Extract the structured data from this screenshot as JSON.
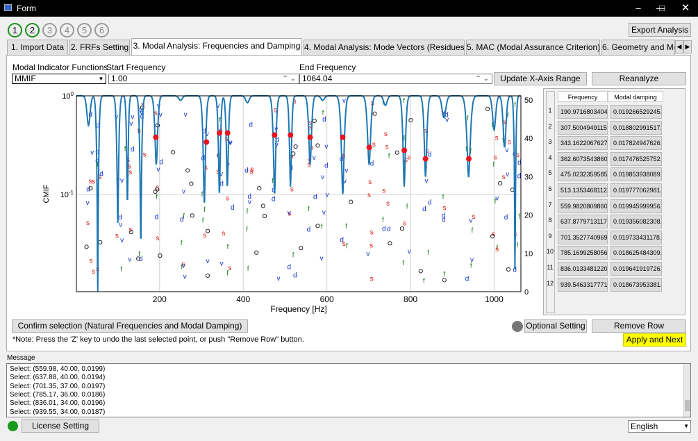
{
  "window": {
    "title": "Form"
  },
  "steps": [
    {
      "n": "1",
      "done": true
    },
    {
      "n": "2",
      "done": true
    },
    {
      "n": "3",
      "done": false
    },
    {
      "n": "4",
      "done": false
    },
    {
      "n": "5",
      "done": false
    },
    {
      "n": "6",
      "done": false
    }
  ],
  "export_label": "Export Analysis",
  "tabs": [
    "1. Import Data",
    "2. FRFs Setting",
    "3. Modal Analysis: Frequencies and Damping",
    "4. Modal Analysis: Mode Vectors (Residues)",
    "5. MAC (Modal Assurance Criterion)",
    "6. Geometry and Mo"
  ],
  "controls": {
    "mif_label": "Modal Indicator Functions",
    "mif_value": "MMIF",
    "start_label": "Start Frequency",
    "start_value": "1.00",
    "end_label": "End Frequency",
    "end_value": "1064.04",
    "update_label": "Update X-Axis Range",
    "reanalyze_label": "Reanalyze"
  },
  "chart_data": {
    "type": "line",
    "xlabel": "Frequency [Hz]",
    "ylabel": "CMIF",
    "x_ticks": [
      "200",
      "400",
      "600",
      "800",
      "1000"
    ],
    "y_ticks_left": [
      "10^0",
      "10^-1"
    ],
    "y_ticks_right": [
      "0",
      "10",
      "20",
      "30",
      "40",
      "50"
    ],
    "xlim": [
      1,
      1064.04
    ],
    "ylog": true,
    "grid": true,
    "selected_points": [
      [
        190.97,
        0.38
      ],
      [
        312,
        0.34
      ],
      [
        343.16,
        0.42
      ],
      [
        362.61,
        0.42
      ],
      [
        475.02,
        0.4
      ],
      [
        513.14,
        0.4
      ],
      [
        559.98,
        0.38
      ],
      [
        637.88,
        0.38
      ],
      [
        701.35,
        0.3
      ],
      [
        785.17,
        0.28
      ],
      [
        836.01,
        0.23
      ],
      [
        939.55,
        0.23
      ]
    ]
  },
  "table": {
    "headers": [
      "Frequency",
      "Modal damping"
    ],
    "rows": [
      [
        "1",
        "190.9716803404...",
        "0.019266529245..."
      ],
      [
        "2",
        "307.5004949115...",
        "0.018802991517..."
      ],
      [
        "3",
        "343.1622067627...",
        "0.017824947626..."
      ],
      [
        "4",
        "362.6073543860...",
        "0.017476525752..."
      ],
      [
        "5",
        "475.0232359585...",
        "0.019853938089..."
      ],
      [
        "6",
        "513.1353468112...",
        "0.019777062981..."
      ],
      [
        "7",
        "559.9820809860...",
        "0.019945999956..."
      ],
      [
        "8",
        "637.8779713117...",
        "0.019356082308..."
      ],
      [
        "9",
        "701.3527740969...",
        "0.019733431178..."
      ],
      [
        "10",
        "785.1699258056...",
        "0.018625484309..."
      ],
      [
        "11",
        "836.0133481220...",
        "0.019641919726..."
      ],
      [
        "12",
        "939.5463317771...",
        "0.018673953381..."
      ]
    ]
  },
  "bottom": {
    "confirm_label": "Confirm selection (Natural Frequencies and Modal Damping)",
    "note": "*Note: Press the 'Z' key to undo the last selected point, or push \"Remove Row\" button.",
    "optional_label": "Optional Setting",
    "remove_label": "Remove Row",
    "apply_label": "Apply and Next"
  },
  "message": {
    "label": "Message",
    "lines": [
      "Select: (559.98, 40.00, 0.0199)",
      "Select: (637.88, 40.00, 0.0194)",
      "Select: (701.35, 37.00, 0.0197)",
      "Select: (785.17, 36.00, 0.0186)",
      "Select: (836.01, 34.00, 0.0196)",
      "Select: (939.55, 34.00, 0.0187)"
    ]
  },
  "footer": {
    "license_label": "License Setting",
    "language": "English"
  },
  "colors": {
    "curve": "#1f77b4",
    "selected": "#e8141e",
    "apply_bg": "#ffff00",
    "status_ok": "#1a9a1a"
  }
}
